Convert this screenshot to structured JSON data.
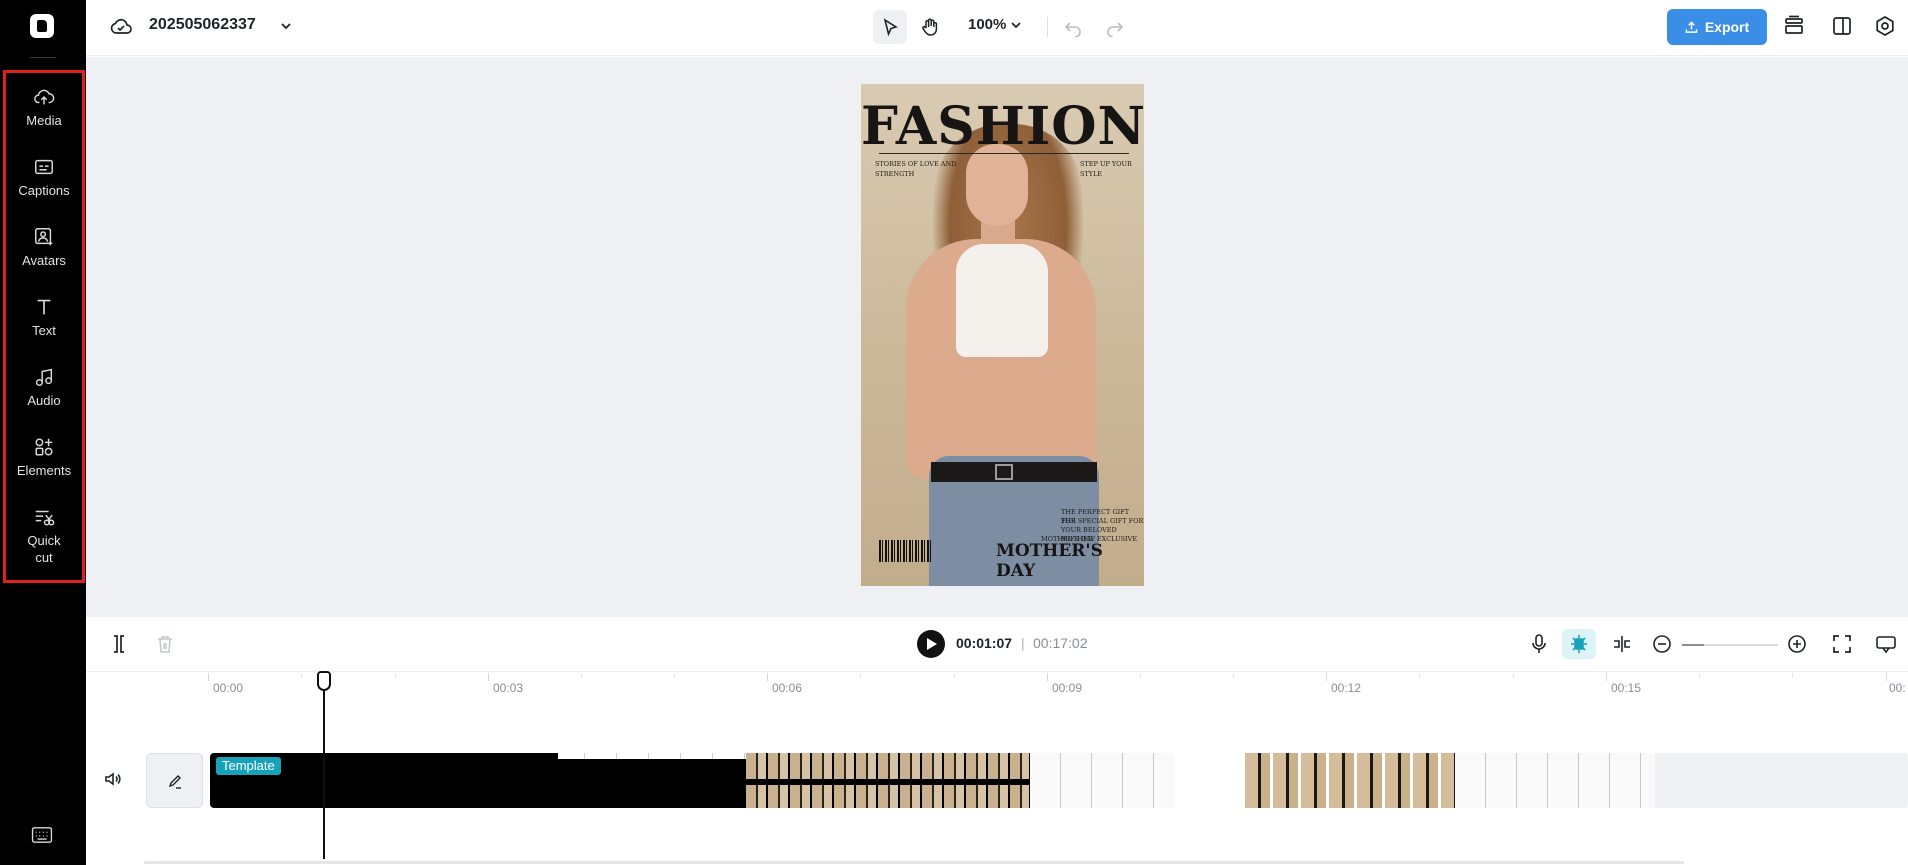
{
  "app": {
    "project_name": "202505062337",
    "zoom_level": "100%",
    "export_label": "Export"
  },
  "sidebar": {
    "items": [
      {
        "label": "Media",
        "icon": "cloud-upload-icon"
      },
      {
        "label": "Captions",
        "icon": "captions-icon"
      },
      {
        "label": "Avatars",
        "icon": "avatar-icon"
      },
      {
        "label": "Text",
        "icon": "text-icon"
      },
      {
        "label": "Audio",
        "icon": "music-note-icon"
      },
      {
        "label": "Elements",
        "icon": "elements-icon"
      },
      {
        "label": "Quick\ncut",
        "icon": "quick-cut-icon"
      }
    ],
    "highlight_color": "#e02020"
  },
  "poster": {
    "title": "FASHION",
    "left_tagline": "STORIES OF LOVE AND STRENGTH",
    "right_tagline": "STEP UP YOUR STYLE",
    "small_lines": [
      "THE PERFECT GIFT FOR",
      "THE SPECIAL GIFT FOR",
      "YOUR BELOVED MOTHER",
      "MOTHER'S DAY EXCLUSIVE"
    ],
    "subtitle": "MOTHER'S DAY"
  },
  "player": {
    "current_time": "00:01:07",
    "separator": "|",
    "total_time": "00:17:02"
  },
  "timeline": {
    "ruler": [
      "00:00",
      "00:03",
      "00:06",
      "00:09",
      "00:12",
      "00:15",
      "00:"
    ],
    "clip_badge": "Template"
  },
  "colors": {
    "accent": "#3a8ee6",
    "rail_bg": "#000000",
    "canvas_bg": "#eef0f4",
    "badge": "#17a2b8"
  }
}
